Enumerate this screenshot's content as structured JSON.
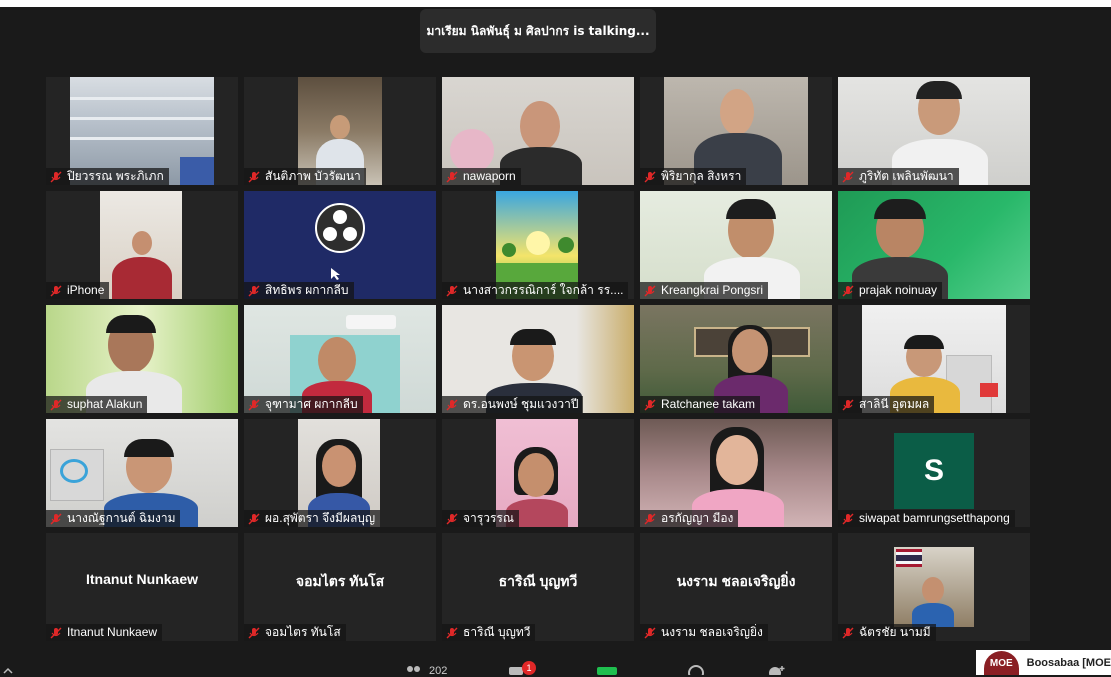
{
  "speaker_banner": {
    "text": "มาเรียม นิลพันธุ์ ม ศิลปากร is  talking..."
  },
  "participants": [
    {
      "name": "ปิยวรรณ พระภิเภก"
    },
    {
      "name": "สันติภาพ บัวรัฒนา"
    },
    {
      "name": "nawaporn"
    },
    {
      "name": "พิริยากุล สิงหรา"
    },
    {
      "name": "ภูริทัต เพลินพัฒนา"
    },
    {
      "name": "iPhone"
    },
    {
      "name": "สิทธิพร ผกากลีบ"
    },
    {
      "name": "นางสาวกรรณิการ์  ใจกล้า  รร...."
    },
    {
      "name": "Kreangkrai Pongsri"
    },
    {
      "name": "prajak noinuay"
    },
    {
      "name": "suphat Alakun"
    },
    {
      "name": "จุฑามาศ ผกากลีบ"
    },
    {
      "name": "ดร.อนพงษ์ ชุมแวงวาปี"
    },
    {
      "name": "Ratchanee takam"
    },
    {
      "name": "สาลินี อุตมผล"
    },
    {
      "name": "นางณัฐกานต์  ฉิมงาม"
    },
    {
      "name": "ผอ.สุพัตรา จึงมีผลบุญ"
    },
    {
      "name": "จารุวรรณ"
    },
    {
      "name": "อรกัญญา  มีอง"
    },
    {
      "name": "siwapat bamrungsetthapong",
      "avatar_letter": "S"
    },
    {
      "name": "Itnanut Nunkaew",
      "display_name": "Itnanut Nunkaew"
    },
    {
      "name": "จอมไตร ทันโส",
      "display_name": "จอมไตร ทันโส"
    },
    {
      "name": "ธาริณี บุญทวี",
      "display_name": "ธาริณี บุญทวี"
    },
    {
      "name": "นงราม ชลอเจริญยิ่ง",
      "display_name": "นงราม ชลอเจริญยิ่ง"
    },
    {
      "name": "ฉัตรชัย นามมี"
    }
  ],
  "toolbar": {
    "participants_count": "202",
    "chat_badge": "1"
  },
  "notification": {
    "logo_text": "MOE",
    "text": "Boosabaa [MOE"
  },
  "colors": {
    "mic_muted": "#e02828",
    "avatar_bg": "#0b5d47",
    "tile_bg": "#242424"
  }
}
